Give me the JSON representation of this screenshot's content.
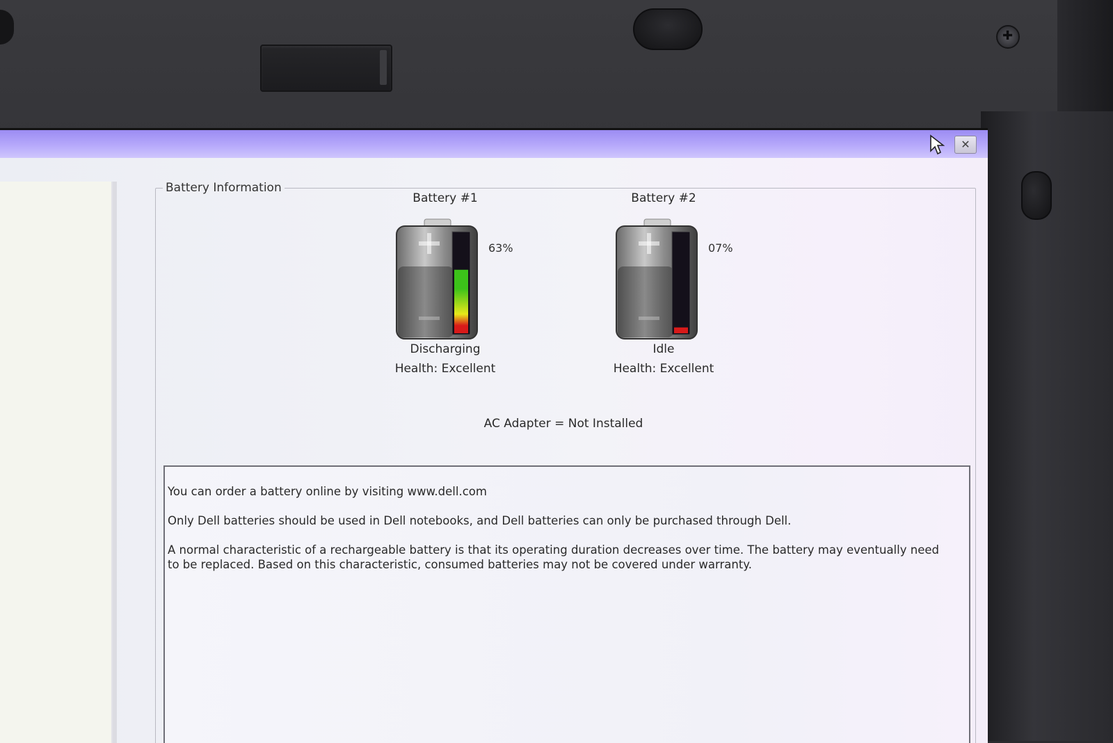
{
  "window": {
    "close_glyph": "✕"
  },
  "group_title": "Battery Information",
  "batteries": [
    {
      "title": "Battery #1",
      "percent": "63%",
      "charge_level": 0.63,
      "status": "Discharging",
      "health": "Health: Excellent"
    },
    {
      "title": "Battery #2",
      "percent": "07%",
      "charge_level": 0.07,
      "status": "Idle",
      "health": "Health: Excellent"
    }
  ],
  "ac_adapter": "AC Adapter = Not Installed",
  "info": {
    "line1": "You can order a battery online by visiting www.dell.com",
    "line2": "Only Dell batteries should be used in Dell notebooks, and Dell batteries can only be purchased through Dell.",
    "line3": "A normal characteristic of a rechargeable battery is that its operating duration decreases over time.  The battery may eventually need to be replaced.  Based on this characteristic, consumed batteries may not be covered under warranty."
  },
  "colors": {
    "titlebar": "#b6a9fb",
    "charge_high": "#3cc21a",
    "charge_mid": "#e8e81a",
    "charge_low": "#d81a1a"
  }
}
